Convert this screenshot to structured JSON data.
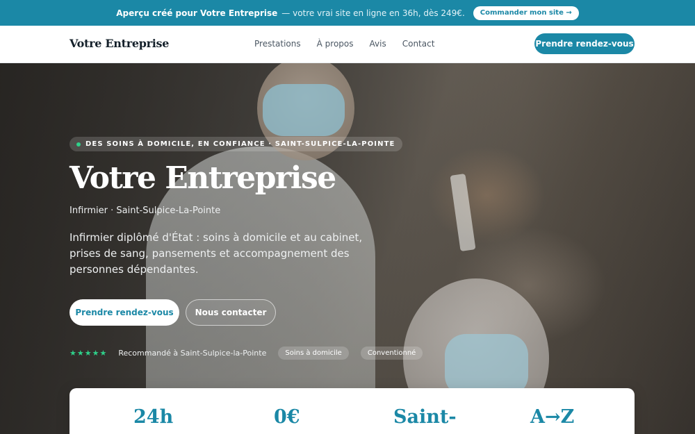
{
  "banner": {
    "lead": "Aperçu créé pour Votre Entreprise",
    "text": "— votre vrai site en ligne en 36h, dès 249€.",
    "cta": "Commander mon site →"
  },
  "nav": {
    "brand": "Votre Entreprise",
    "items": [
      {
        "label": "Prestations"
      },
      {
        "label": "À propos"
      },
      {
        "label": "Avis"
      },
      {
        "label": "Contact"
      }
    ],
    "cta": "Prendre rendez-vous"
  },
  "hero": {
    "eyebrow": "DES SOINS À DOMICILE, EN CONFIANCE · SAINT-SULPICE-LA-POINTE",
    "title": "Votre Entreprise",
    "subtitle": "Infirmier · Saint-Sulpice-La-Pointe",
    "description": "Infirmier diplômé d'État : soins à domicile et au cabinet, prises de sang, pansements et accompagnement des personnes dépendantes.",
    "primary_cta": "Prendre rendez-vous",
    "secondary_cta": "Nous contacter",
    "stars": "★★★★★",
    "trust_text": "Recommandé à Saint-Sulpice-la-Pointe",
    "chips": [
      "Soins à domicile",
      "Conventionné"
    ]
  },
  "stats": [
    "24h",
    "0€",
    "Saint-",
    "A→Z"
  ],
  "colors": {
    "accent": "#1b88a6",
    "green": "#2fd08a"
  }
}
